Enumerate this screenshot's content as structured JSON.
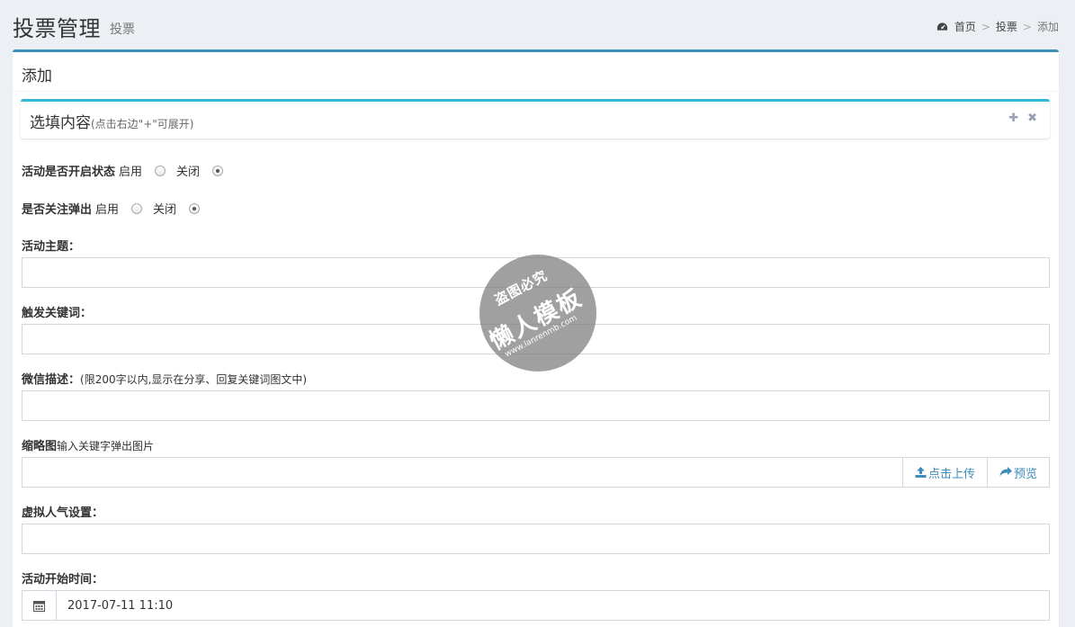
{
  "header": {
    "title": "投票管理",
    "subtitle": "投票",
    "breadcrumb": [
      "首页",
      "投票",
      "添加"
    ],
    "breadcrumb_sep": ">"
  },
  "box": {
    "title": "添加",
    "accent": "#3c8dbc"
  },
  "optional_panel": {
    "title": "选填内容",
    "hint": "(点击右边\"+\"可展开)",
    "accent": "#2fb8d9",
    "expand_icon": "plus-icon",
    "close_icon": "close-icon",
    "expand_glyph": "✚",
    "close_glyph": "✖"
  },
  "form": {
    "activity_enabled": {
      "label": "活动是否开启状态",
      "options": [
        "启用",
        "关闭"
      ],
      "selected": "关闭"
    },
    "follow_popup": {
      "label": "是否关注弹出",
      "options": [
        "启用",
        "关闭"
      ],
      "selected": "关闭"
    },
    "theme": {
      "label": "活动主题：",
      "value": ""
    },
    "keyword": {
      "label": "触发关键词：",
      "value": ""
    },
    "wechat_desc": {
      "label": "微信描述：",
      "hint": "(限200字以内,显示在分享、回复关键词图文中)",
      "value": ""
    },
    "thumbnail": {
      "label": "缩略图",
      "hint": "输入关键字弹出图片",
      "value": "",
      "upload_label": "点击上传",
      "preview_label": "预览",
      "upload_icon": "upload-icon",
      "preview_icon": "share-icon"
    },
    "virtual_popularity": {
      "label": "虚拟人气设置：",
      "value": ""
    },
    "start_time": {
      "label": "活动开始时间：",
      "value": "2017-07-11 11:10",
      "icon": "calendar-icon"
    }
  },
  "watermark": {
    "top": "盗图必究",
    "main": "懒人模板",
    "url": "www.lanrenmb.com"
  }
}
